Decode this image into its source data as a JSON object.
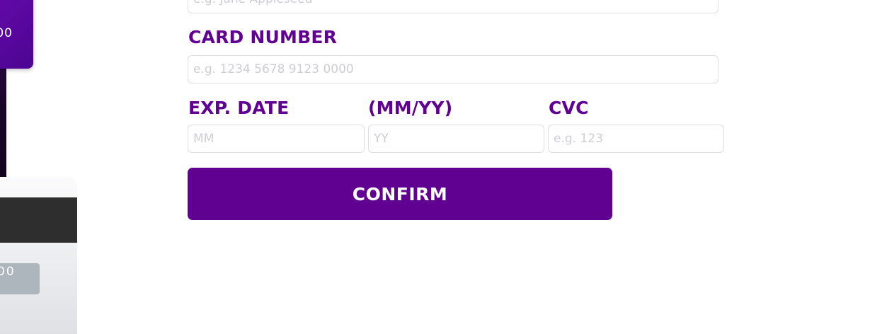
{
  "preview": {
    "front_number_fragment": "00",
    "back_cvc_fragment": "00"
  },
  "form": {
    "cardholder_placeholder": "e.g. Jane Appleseed",
    "card_number_label": "CARD NUMBER",
    "card_number_placeholder": "e.g. 1234 5678 9123 0000",
    "exp_date_label": "EXP. DATE",
    "exp_format_label": "(MM/YY)",
    "cvc_label": "CVC",
    "month_placeholder": "MM",
    "year_placeholder": "YY",
    "cvc_placeholder": "e.g. 123",
    "confirm_label": "CONFIRM"
  },
  "colors": {
    "accent": "#610192",
    "input_border": "#dedde3",
    "placeholder": "#cfcdd4"
  }
}
